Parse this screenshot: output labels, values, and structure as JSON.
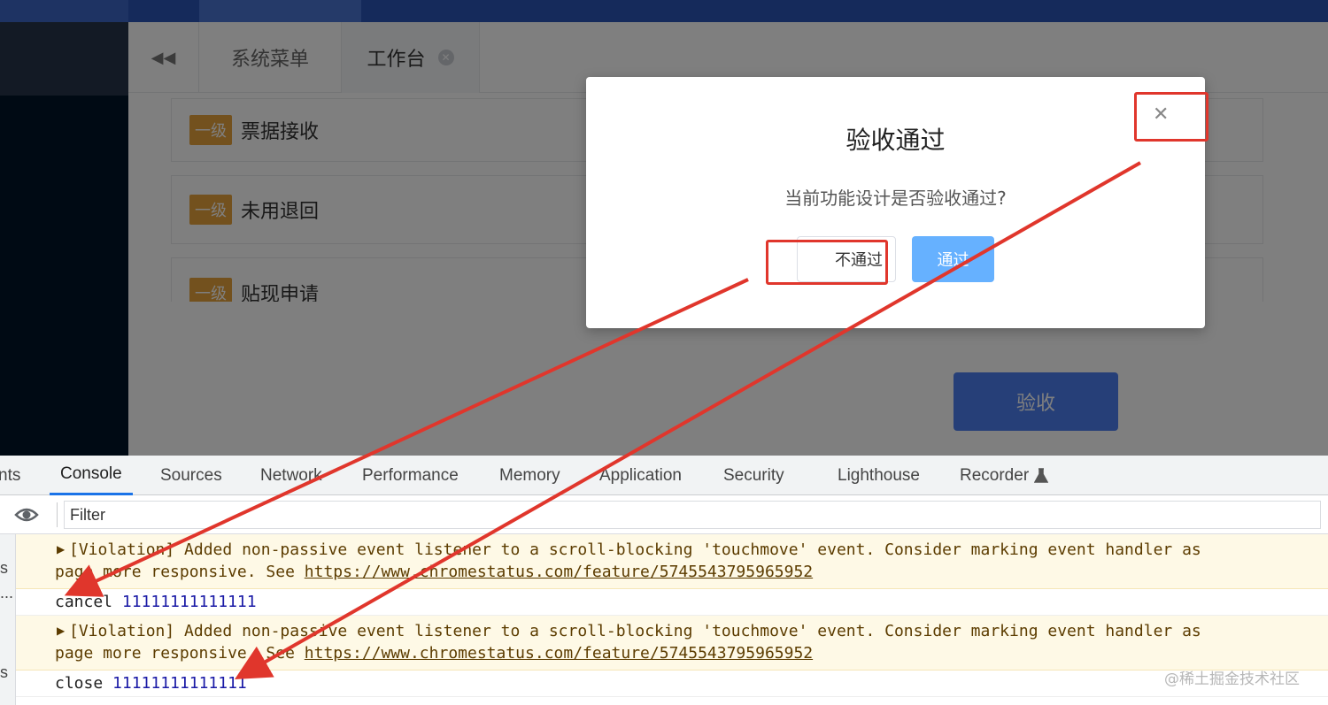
{
  "tabs": {
    "collapse_glyph": "◀◀",
    "menu": "系统菜单",
    "workbench": "工作台",
    "workbench_close_glyph": "✕"
  },
  "menu_cards": [
    {
      "level": "一级",
      "name": "票据接收"
    },
    {
      "level": "一级",
      "name": "未用退回"
    },
    {
      "level": "一级",
      "name": "贴现申请"
    }
  ],
  "accept_button": "验收",
  "modal": {
    "title": "验收通过",
    "message": "当前功能设计是否验收通过?",
    "close_glyph": "✕",
    "fail_button": "不通过",
    "pass_button": "通过"
  },
  "devtools": {
    "tabs": [
      "nts",
      "Console",
      "Sources",
      "Network",
      "Performance",
      "Memory",
      "Application",
      "Security",
      "Lighthouse",
      "Recorder"
    ],
    "recorder_icon": "flask-icon",
    "filter_placeholder": "Filter",
    "left_fragments": [
      "s",
      "...",
      "s"
    ],
    "warning": {
      "line1": "[Violation] Added non-passive event listener to a scroll-blocking 'touchmove' event. Consider marking event handler as",
      "line2_prefix": "page more responsive. See ",
      "line2_link": "https://www.chromestatus.com/feature/5745543795965952"
    },
    "logs": [
      {
        "label": "cancel",
        "value": "11111111111111"
      },
      {
        "label": "close",
        "value": "11111111111111"
      }
    ]
  },
  "watermark": "@稀土掘金技术社区",
  "colors": {
    "annotation": "#e0362c",
    "primary": "#4c7ff0",
    "warning_bg": "#fef9e6"
  }
}
